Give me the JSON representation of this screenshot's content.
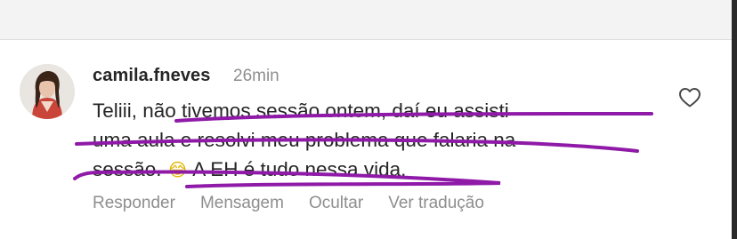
{
  "comment": {
    "username": "camila.fneves",
    "timestamp": "26min",
    "lines": [
      "Teliii, não tivemos sessão ontem, daí eu assisti",
      "uma aula e resolvi meu problema que falaria na",
      "sessão.",
      "A EH é tudo nessa vida."
    ],
    "emoji": "😂",
    "like_icon": "heart-outline-icon",
    "annotation_color": "#8f1aa8"
  },
  "actions": {
    "reply": "Responder",
    "message": "Mensagem",
    "hide": "Ocultar",
    "translate": "Ver tradução"
  },
  "colors": {
    "text": "#262626",
    "muted": "#8e8e8e",
    "top_band": "#f3f3f3"
  }
}
